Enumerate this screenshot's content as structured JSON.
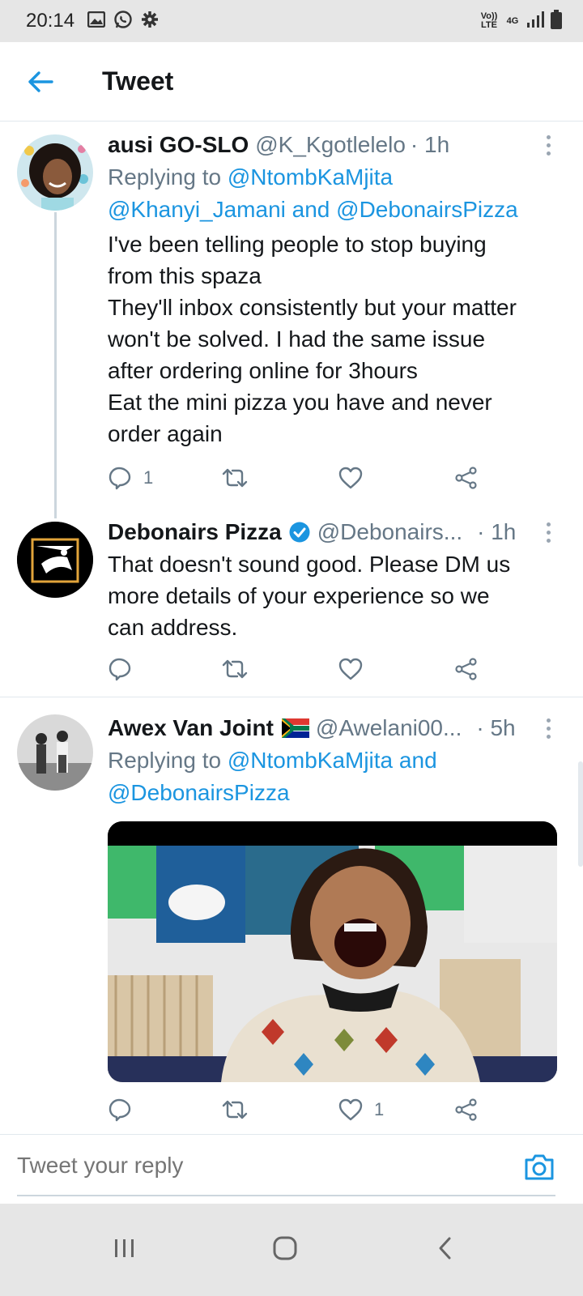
{
  "status_bar": {
    "time": "20:14",
    "network_volte": "Vo)) LTE",
    "network_type": "4G",
    "icons": [
      "gallery-icon",
      "whatsapp-icon",
      "settings-icon",
      "signal-icon",
      "battery-icon"
    ]
  },
  "header": {
    "title": "Tweet",
    "back_icon": "back-arrow-icon"
  },
  "tweets": [
    {
      "name": "ausi GO-SLO",
      "handle": "@K_Kgotlelelo",
      "time": "· 1h",
      "replying_prefix": "Replying to",
      "replying_to": [
        "@NtombKaMjita",
        "@Khanyi_Jamani",
        "@DebonairsPizza"
      ],
      "replying_joiner": "and",
      "text_lines": [
        "I've been telling people to stop buying",
        "from this spaza",
        "They'll inbox consistently but your matter",
        "won't be solved. I had the same issue",
        "after ordering online for 3hours",
        "Eat the mini pizza you have and never",
        "order again"
      ],
      "reply_count": "1",
      "retweet_count": "",
      "like_count": ""
    },
    {
      "name": "Debonairs Pizza",
      "verified": true,
      "handle": "@Debonairs...",
      "time": "· 1h",
      "text_lines": [
        "That doesn't sound good. Please DM us",
        "more details of your experience so we",
        "can address."
      ],
      "reply_count": "",
      "retweet_count": "",
      "like_count": ""
    },
    {
      "name": "Awex Van Joint",
      "flag": "🇿🇦",
      "handle": "@Awelani00...",
      "time": "· 5h",
      "replying_prefix": "Replying to",
      "replying_to": [
        "@NtombKaMjita",
        "@DebonairsPizza"
      ],
      "replying_joiner": "and",
      "has_media": true,
      "reply_count": "",
      "retweet_count": "",
      "like_count": "1"
    }
  ],
  "reply_box": {
    "placeholder": "Tweet your reply"
  },
  "colors": {
    "accent": "#1b95e0",
    "text_primary": "#14171a",
    "text_secondary": "#657786",
    "divider": "#e1e8ed",
    "system_bar": "#e6e6e6"
  }
}
